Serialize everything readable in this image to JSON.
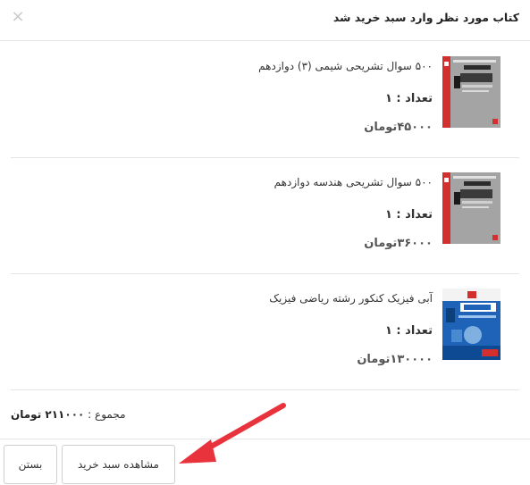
{
  "header": {
    "title": "کتاب مورد نظر وارد سبد خرید شد",
    "close_symbol": "×"
  },
  "items": [
    {
      "name": "۵۰۰ سوال تشریحی شیمی (۳) دوازدهم",
      "quantity": "تعداد : ۱",
      "price": "۴۵۰۰۰تومان",
      "cover_color": "#9e9e9e"
    },
    {
      "name": "۵۰۰ سوال تشریحی هندسه دوازدهم",
      "quantity": "تعداد : ۱",
      "price": "۳۶۰۰۰تومان",
      "cover_color": "#9e9e9e"
    },
    {
      "name": "آبی فیزیک کنکور رشته ریاضی فیزیک",
      "quantity": "تعداد : ۱",
      "price": "۱۳۰۰۰۰تومان",
      "cover_color": "#1a5fb4"
    }
  ],
  "total": {
    "label": "مجموع :",
    "amount": "۲۱۱۰۰۰ تومان"
  },
  "footer": {
    "view_cart_label": "مشاهده سبد خرید",
    "close_label": "بستن"
  },
  "colors": {
    "annotation_arrow": "#e8333c",
    "divider": "#e5e5e5"
  }
}
